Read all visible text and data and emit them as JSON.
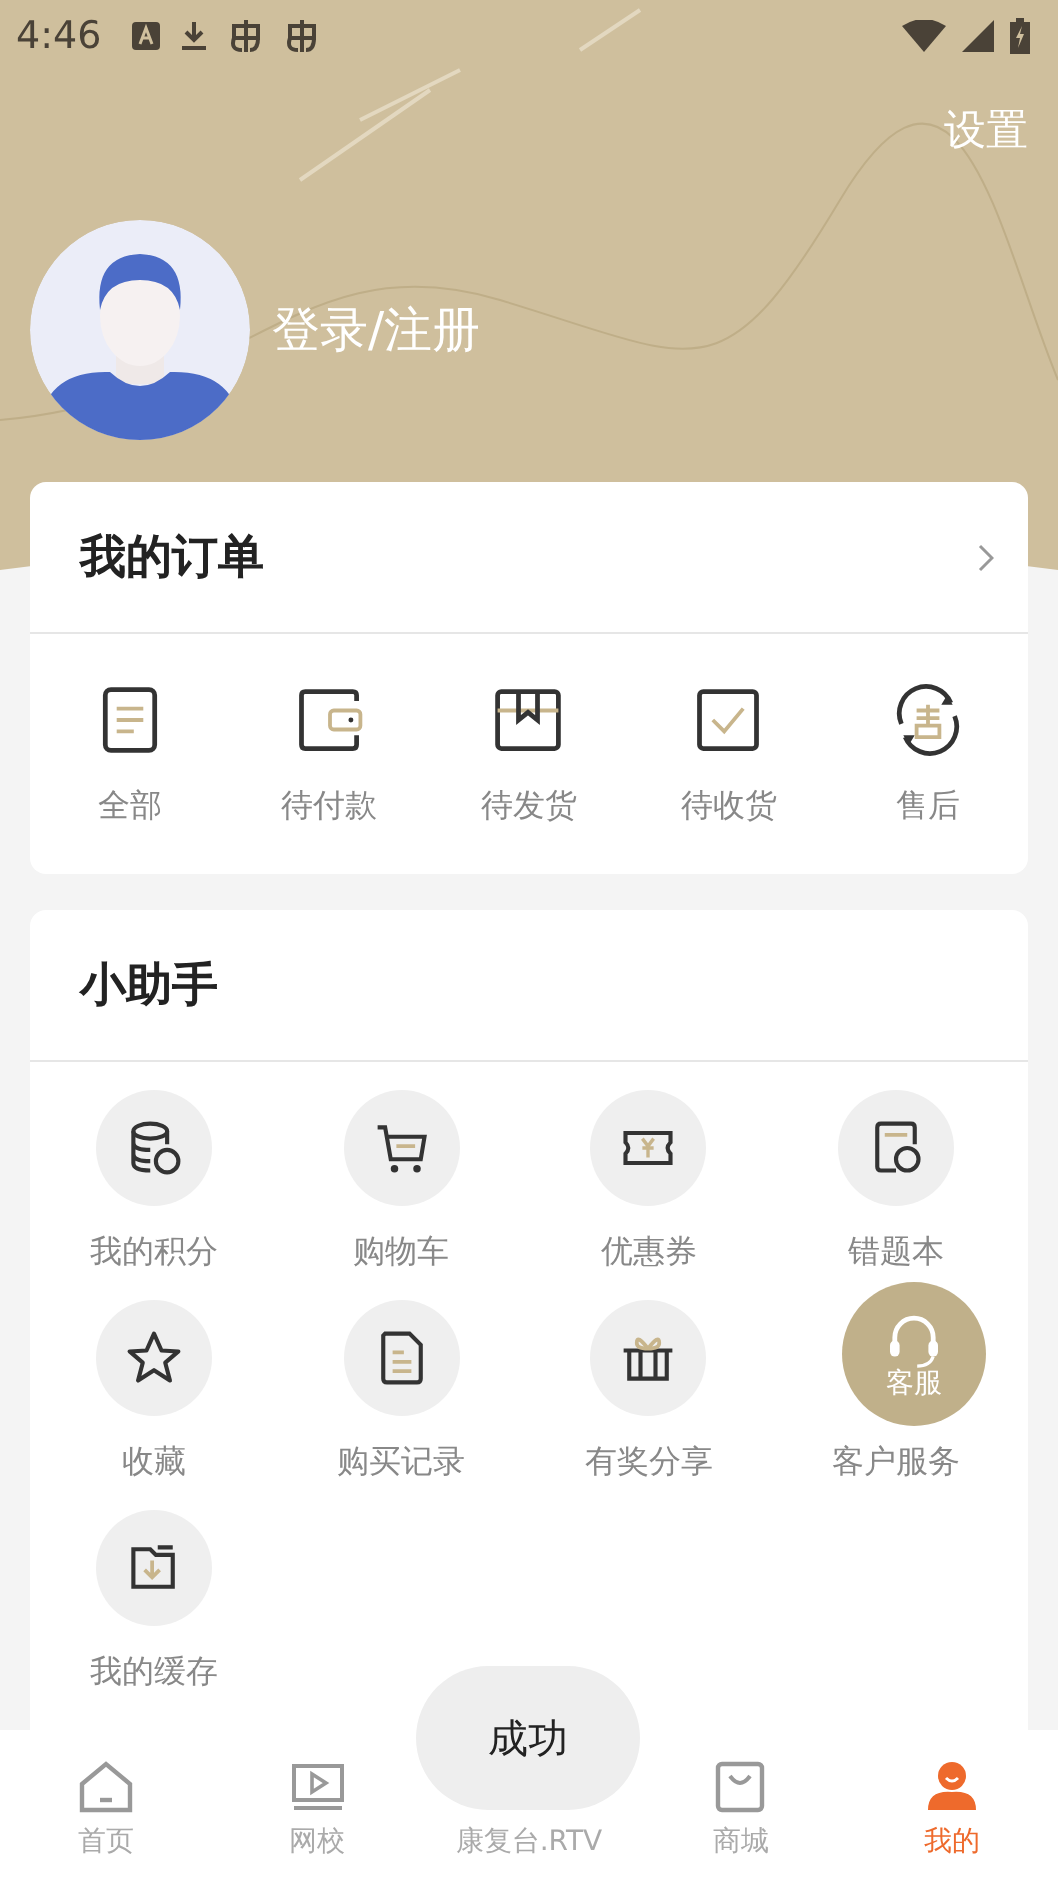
{
  "status_bar": {
    "time": "4:46"
  },
  "header": {
    "settings": "设置",
    "login": "登录/注册"
  },
  "orders": {
    "title": "我的订单",
    "items": [
      {
        "label": "全部"
      },
      {
        "label": "待付款"
      },
      {
        "label": "待发货"
      },
      {
        "label": "待收货"
      },
      {
        "label": "售后"
      }
    ]
  },
  "helper": {
    "title": "小助手",
    "items": [
      {
        "label": "我的积分"
      },
      {
        "label": "购物车"
      },
      {
        "label": "优惠券"
      },
      {
        "label": "错题本"
      },
      {
        "label": "收藏"
      },
      {
        "label": "购买记录"
      },
      {
        "label": "有奖分享"
      },
      {
        "label": "客户服务"
      },
      {
        "label": "我的缓存"
      }
    ]
  },
  "floating_button": {
    "label": "客服"
  },
  "toast": {
    "text": "成功"
  },
  "tabs": [
    {
      "label": "首页",
      "selected": false
    },
    {
      "label": "网校",
      "selected": false
    },
    {
      "label": "康复台.RTV",
      "selected": false
    },
    {
      "label": "商城",
      "selected": false
    },
    {
      "label": "我的",
      "selected": true
    }
  ]
}
